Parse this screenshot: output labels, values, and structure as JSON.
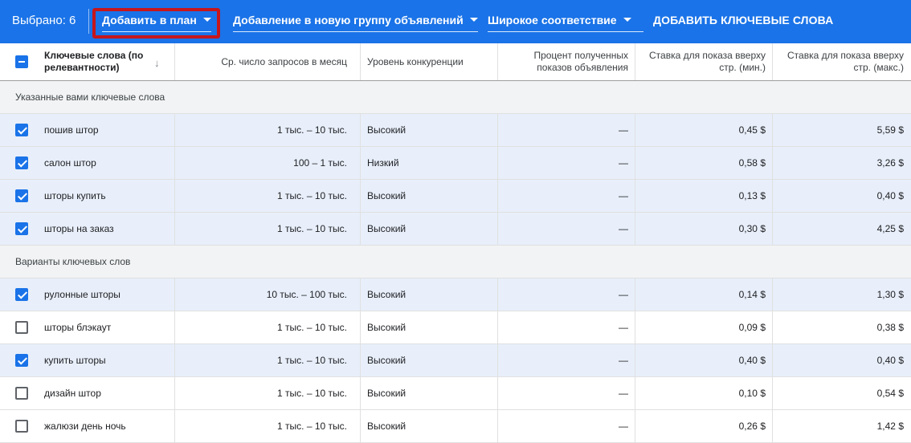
{
  "toolbar": {
    "selected_label": "Выбрано: 6",
    "add_to_plan": "Добавить в план",
    "add_to_group": "Добавление в новую группу объявлений",
    "match_type": "Широкое соответствие",
    "add_keywords": "ДОБАВИТЬ КЛЮЧЕВЫЕ СЛОВА",
    "highlight_color": "#c5161d",
    "background_color": "#1a73e8"
  },
  "columns": {
    "keyword": "Ключевые слова (по релевантности)",
    "avg_searches": "Ср. число запросов в месяц",
    "competition": "Уровень конкуренции",
    "impression_share": "Процент полученных показов объявления",
    "bid_low": "Ставка для показа вверху стр. (мин.)",
    "bid_high": "Ставка для показа вверху стр. (макс.)"
  },
  "sections": [
    {
      "title": "Указанные вами ключевые слова",
      "rows": [
        {
          "checked": true,
          "keyword": "пошив штор",
          "avg": "1 тыс. – 10 тыс.",
          "competition": "Высокий",
          "share": "—",
          "low": "0,45 $",
          "high": "5,59 $"
        },
        {
          "checked": true,
          "keyword": "салон штор",
          "avg": "100 – 1 тыс.",
          "competition": "Низкий",
          "share": "—",
          "low": "0,58 $",
          "high": "3,26 $"
        },
        {
          "checked": true,
          "keyword": "шторы купить",
          "avg": "1 тыс. – 10 тыс.",
          "competition": "Высокий",
          "share": "—",
          "low": "0,13 $",
          "high": "0,40 $"
        },
        {
          "checked": true,
          "keyword": "шторы на заказ",
          "avg": "1 тыс. – 10 тыс.",
          "competition": "Высокий",
          "share": "—",
          "low": "0,30 $",
          "high": "4,25 $"
        }
      ]
    },
    {
      "title": "Варианты ключевых слов",
      "rows": [
        {
          "checked": true,
          "keyword": "рулонные шторы",
          "avg": "10 тыс. – 100 тыс.",
          "competition": "Высокий",
          "share": "—",
          "low": "0,14 $",
          "high": "1,30 $"
        },
        {
          "checked": false,
          "keyword": "шторы блэкаут",
          "avg": "1 тыс. – 10 тыс.",
          "competition": "Высокий",
          "share": "—",
          "low": "0,09 $",
          "high": "0,38 $"
        },
        {
          "checked": true,
          "keyword": "купить шторы",
          "avg": "1 тыс. – 10 тыс.",
          "competition": "Высокий",
          "share": "—",
          "low": "0,40 $",
          "high": "0,40 $"
        },
        {
          "checked": false,
          "keyword": "дизайн штор",
          "avg": "1 тыс. – 10 тыс.",
          "competition": "Высокий",
          "share": "—",
          "low": "0,10 $",
          "high": "0,54 $"
        },
        {
          "checked": false,
          "keyword": "жалюзи день ночь",
          "avg": "1 тыс. – 10 тыс.",
          "competition": "Высокий",
          "share": "—",
          "low": "0,26 $",
          "high": "1,42 $"
        }
      ]
    }
  ]
}
